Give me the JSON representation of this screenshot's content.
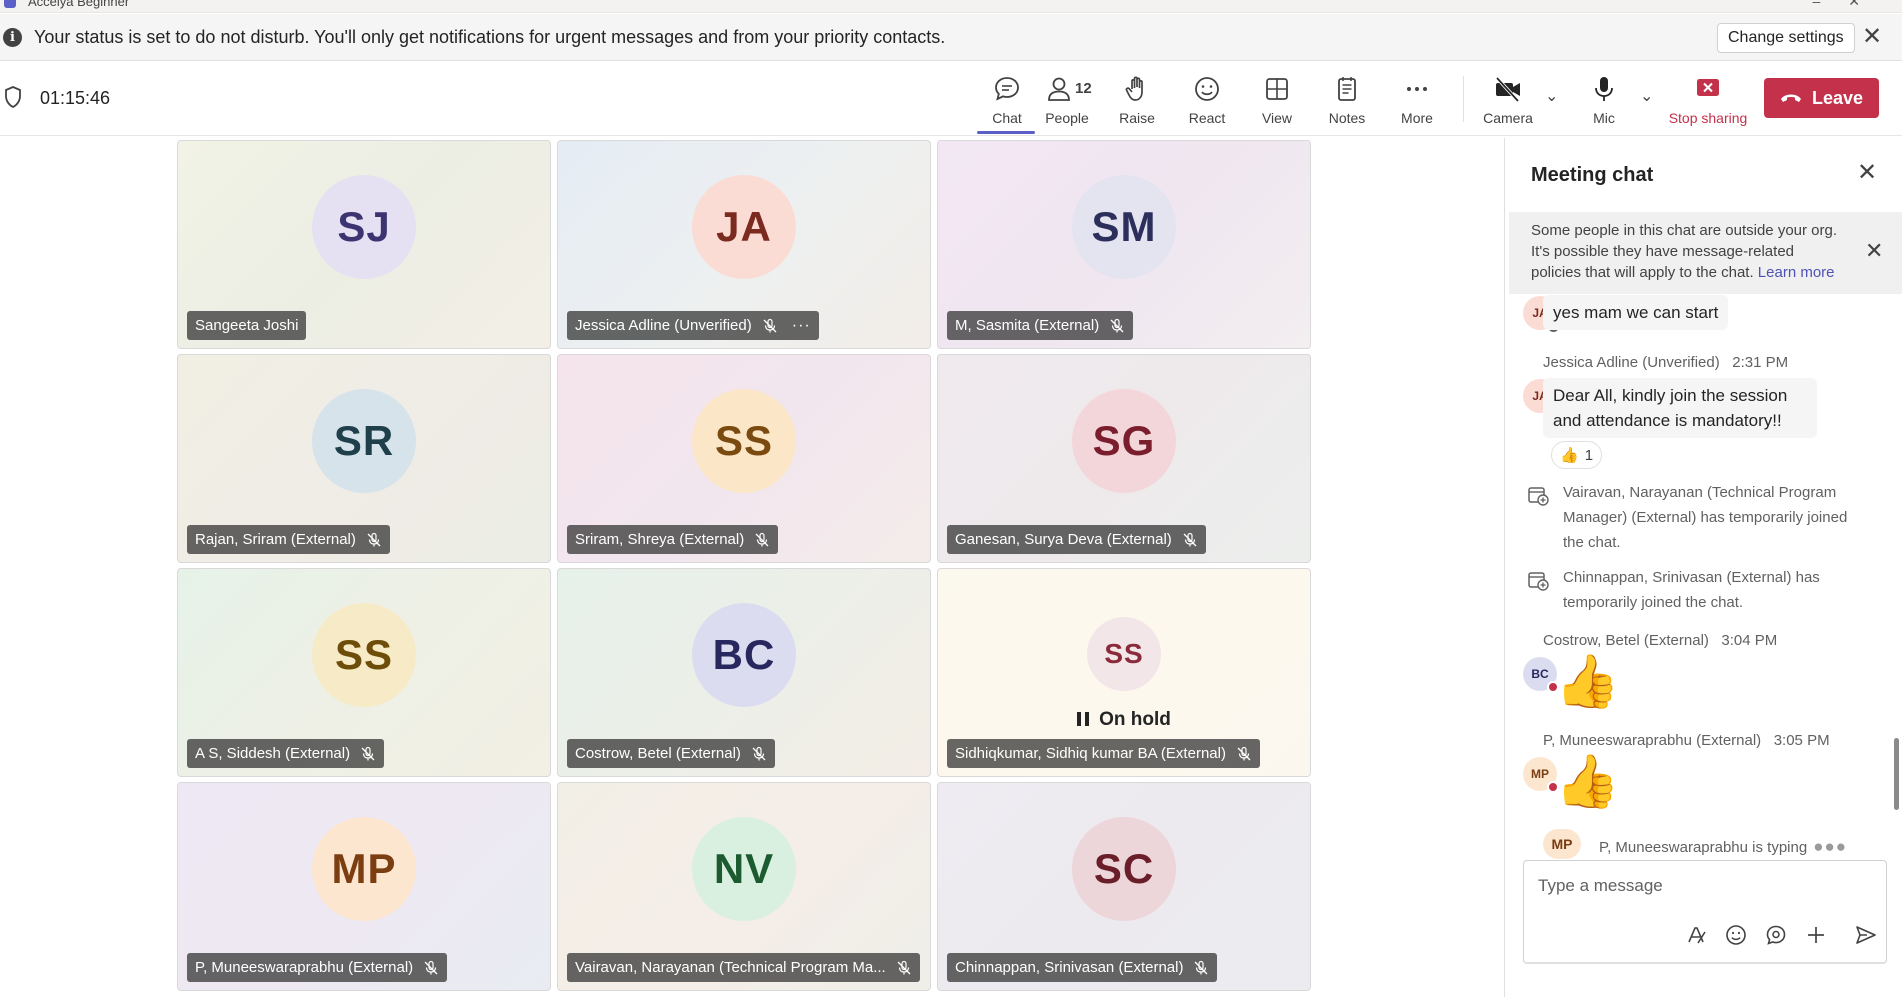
{
  "window": {
    "title": "Accelya Beginner"
  },
  "banner": {
    "message": "Your status is set to do not disturb. You'll only get notifications for urgent messages and from your priority contacts.",
    "button_label": "Change settings"
  },
  "toolbar": {
    "timer": "01:15:46",
    "buttons": {
      "chat": "Chat",
      "people": "People",
      "people_count": "12",
      "raise": "Raise",
      "react": "React",
      "view": "View",
      "notes": "Notes",
      "more": "More",
      "camera": "Camera",
      "mic": "Mic",
      "stop_sharing": "Stop sharing"
    },
    "leave_label": "Leave",
    "accent_color": "#5b5fc7",
    "leave_color": "#c4314b"
  },
  "participants": [
    {
      "initials": "SJ",
      "name": "Sangeeta Joshi",
      "muted": false
    },
    {
      "initials": "JA",
      "name": "Jessica Adline (Unverified)",
      "muted": true
    },
    {
      "initials": "SM",
      "name": "M, Sasmita (External)",
      "muted": true
    },
    {
      "initials": "SR",
      "name": "Rajan, Sriram (External)",
      "muted": true
    },
    {
      "initials": "SS",
      "name": "Sriram, Shreya (External)",
      "muted": true
    },
    {
      "initials": "SG",
      "name": "Ganesan, Surya Deva (External)",
      "muted": true
    },
    {
      "initials": "SS",
      "name": "A S, Siddesh (External)",
      "muted": true
    },
    {
      "initials": "BC",
      "name": "Costrow, Betel (External)",
      "muted": true
    },
    {
      "initials": "SS",
      "name": "Sidhiqkumar, Sidhiq kumar BA (External)",
      "muted": true,
      "status": "On hold"
    },
    {
      "initials": "MP",
      "name": "P, Muneeswaraprabhu (External)",
      "muted": true
    },
    {
      "initials": "NV",
      "name": "Vairavan, Narayanan (Technical Program Ma...",
      "muted": true
    },
    {
      "initials": "SC",
      "name": "Chinnappan, Srinivasan (External)",
      "muted": true
    }
  ],
  "chat": {
    "title": "Meeting chat",
    "policy_notice": "Some people in this chat are outside your org. It's possible they have message-related policies that will apply to the chat.",
    "policy_link": "Learn more",
    "messages": [
      {
        "avatar": "JA",
        "text": "yes mam we can start"
      },
      {
        "sender": "Jessica Adline (Unverified)",
        "time": "2:31 PM",
        "avatar": "JA",
        "text": "Dear All, kindly join the session and attendance is mandatory!!",
        "reaction_emoji": "👍",
        "reaction_count": "1"
      },
      {
        "system": "Vairavan, Narayanan (Technical Program Manager) (External) has temporarily joined the chat."
      },
      {
        "system": "Chinnappan, Srinivasan (External) has temporarily joined the chat."
      },
      {
        "sender": "Costrow, Betel (External)",
        "time": "3:04 PM",
        "avatar": "BC",
        "emoji": "👍"
      },
      {
        "sender": "P, Muneeswaraprabhu (External)",
        "time": "3:05 PM",
        "avatar": "MP",
        "emoji": "👍"
      }
    ],
    "typing_avatar": "MP",
    "typing": "P, Muneeswaraprabhu is typing",
    "compose_placeholder": "Type a message"
  }
}
